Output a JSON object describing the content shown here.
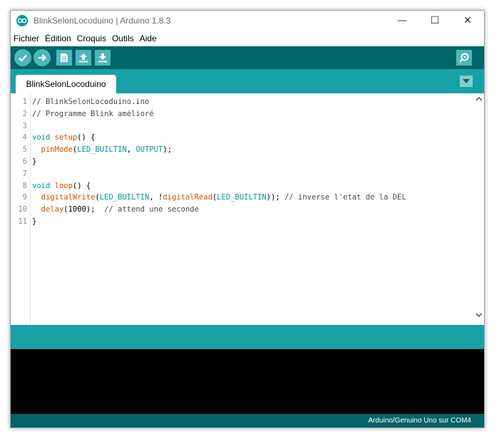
{
  "window": {
    "title": "BlinkSelonLocoduino | Arduino 1.8.3",
    "minimize_glyph": "—",
    "maximize_glyph": "☐",
    "close_glyph": "✕"
  },
  "menu": {
    "items": [
      "Fichier",
      "Édition",
      "Croquis",
      "Outils",
      "Aide"
    ]
  },
  "toolbar": {
    "icons": [
      "verify-icon",
      "upload-icon",
      "new-icon",
      "open-icon",
      "save-icon",
      "serial-monitor-icon"
    ]
  },
  "tabs": {
    "active": "BlinkSelonLocoduino"
  },
  "editor": {
    "line_numbers": [
      "1",
      "2",
      "3",
      "4",
      "5",
      "6",
      "7",
      "8",
      "9",
      "10",
      "11"
    ],
    "lines": [
      [
        {
          "t": "// BlinkSelonLocoduino.ino",
          "c": "cm"
        }
      ],
      [
        {
          "t": "// Programme Blink amélioré",
          "c": "cm"
        }
      ],
      [],
      [
        {
          "t": "void",
          "c": "kw"
        },
        {
          "t": " "
        },
        {
          "t": "setup",
          "c": "fn"
        },
        {
          "t": "() {"
        }
      ],
      [
        {
          "t": "  "
        },
        {
          "t": "pinMode",
          "c": "fn"
        },
        {
          "t": "("
        },
        {
          "t": "LED_BUILTIN",
          "c": "cn"
        },
        {
          "t": ", "
        },
        {
          "t": "OUTPUT",
          "c": "cn"
        },
        {
          "t": ");"
        }
      ],
      [
        {
          "t": "}"
        }
      ],
      [],
      [
        {
          "t": "void",
          "c": "kw"
        },
        {
          "t": " "
        },
        {
          "t": "loop",
          "c": "fn"
        },
        {
          "t": "() {"
        }
      ],
      [
        {
          "t": "  "
        },
        {
          "t": "digitalWrite",
          "c": "fn"
        },
        {
          "t": "("
        },
        {
          "t": "LED_BUILTIN",
          "c": "cn"
        },
        {
          "t": ", !"
        },
        {
          "t": "digitalRead",
          "c": "fn"
        },
        {
          "t": "("
        },
        {
          "t": "LED_BUILTIN",
          "c": "cn"
        },
        {
          "t": ")); "
        },
        {
          "t": "// inverse l'etat de la DEL",
          "c": "cm"
        }
      ],
      [
        {
          "t": "  "
        },
        {
          "t": "delay",
          "c": "fn"
        },
        {
          "t": "(1000);  "
        },
        {
          "t": "// attend une seconde",
          "c": "cm"
        }
      ],
      [
        {
          "t": "}"
        }
      ]
    ]
  },
  "status": {
    "board": "Arduino/Genuino Uno sur COM4"
  },
  "colors": {
    "toolbar": "#006468",
    "tabs": "#17a1a5",
    "button": "#4db7bb",
    "keyword": "#00979c",
    "function": "#d35400"
  }
}
